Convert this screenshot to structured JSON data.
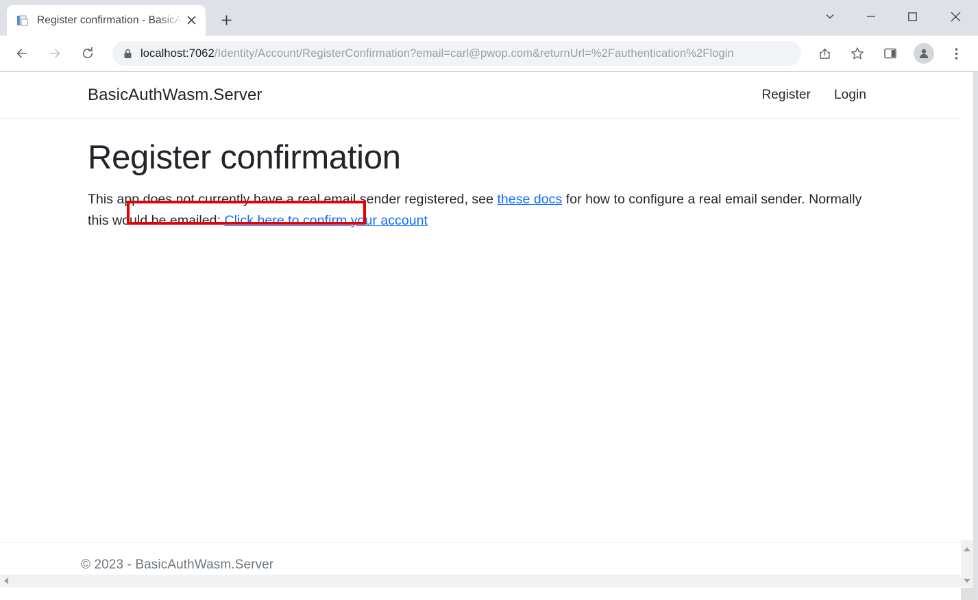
{
  "browser": {
    "tab": {
      "title": "Register confirmation - BasicAuth",
      "favicon": "document-icon",
      "close": "✕"
    },
    "newtab_label": "+",
    "window_controls": {
      "tab_search": "tab-search-icon",
      "minimize": "minimize-icon",
      "maximize": "maximize-icon",
      "close": "close-icon"
    },
    "nav": {
      "back": "back-arrow-icon",
      "forward": "forward-arrow-icon",
      "reload": "reload-icon"
    },
    "omnibox": {
      "lock": "lock-icon",
      "host": "localhost:7062",
      "path": "/Identity/Account/RegisterConfirmation?email=carl@pwop.com&returnUrl=%2Fauthentication%2Flogin",
      "full_url": "localhost:7062/Identity/Account/RegisterConfirmation?email=carl@pwop.com&returnUrl=%2Fauthentication%2Flogin"
    },
    "actions": {
      "share": "share-icon",
      "bookmark": "star-icon",
      "side_panel": "side-panel-icon",
      "profile": "profile-avatar-icon",
      "menu": "three-dot-menu-icon"
    }
  },
  "site": {
    "brand": "BasicAuthWasm.Server",
    "nav": [
      {
        "label": "Register"
      },
      {
        "label": "Login"
      }
    ]
  },
  "page": {
    "title": "Register confirmation",
    "paragraph": {
      "part1": "This app does not currently have a real email sender registered, see ",
      "docs_link": "these docs",
      "part2": " for how to configure a real email sender. Normally this would be emailed: ",
      "confirm_link": "Click here to confirm your account"
    }
  },
  "footer": {
    "text": "© 2023 - BasicAuthWasm.Server"
  },
  "annotation": {
    "color": "#e60000",
    "target": "Click here to confirm your account"
  },
  "scrollbars": {
    "vertical_up": "scroll-up-arrow",
    "vertical_down": "scroll-down-arrow",
    "horizontal_left": "scroll-left-arrow"
  }
}
